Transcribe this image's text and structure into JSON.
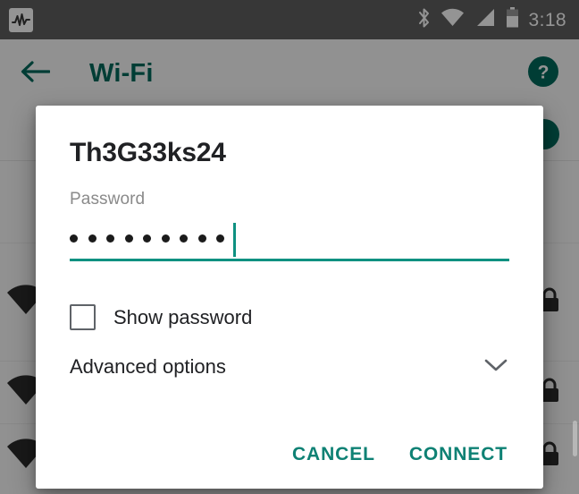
{
  "status_bar": {
    "notification_icon": "activity-waveform-icon",
    "icons": [
      "bluetooth-icon",
      "wifi-icon",
      "cellular-signal-icon",
      "battery-icon"
    ],
    "time": "3:18",
    "background_color": "#5f5f5f",
    "foreground_color": "#ffffff"
  },
  "app_bar": {
    "back_icon": "back-arrow-icon",
    "title": "Wi-Fi",
    "help_icon": "help-circle-icon",
    "accent_color": "#00695c"
  },
  "background_list": {
    "toggle_on": true,
    "rows": [
      {
        "signal_icon": "wifi-signal-icon",
        "lock_icon": "lock-icon"
      },
      {
        "signal_icon": "wifi-signal-icon",
        "lock_icon": "lock-icon"
      },
      {
        "signal_icon": "wifi-signal-icon",
        "lock_icon": "lock-icon"
      }
    ]
  },
  "dialog": {
    "title": "Th3G33ks24",
    "password_label": "Password",
    "password_value": "•••••••••",
    "password_dot_count": 9,
    "password_masked": true,
    "caret_visible": true,
    "show_password": {
      "label": "Show password",
      "checked": false
    },
    "advanced_options": {
      "label": "Advanced options",
      "expanded": false,
      "chevron_icon": "chevron-down-icon"
    },
    "actions": {
      "cancel_label": "CANCEL",
      "connect_label": "CONNECT"
    },
    "accent_color": "#0e8174",
    "underline_color": "#0e9181",
    "background_color": "#ffffff"
  }
}
